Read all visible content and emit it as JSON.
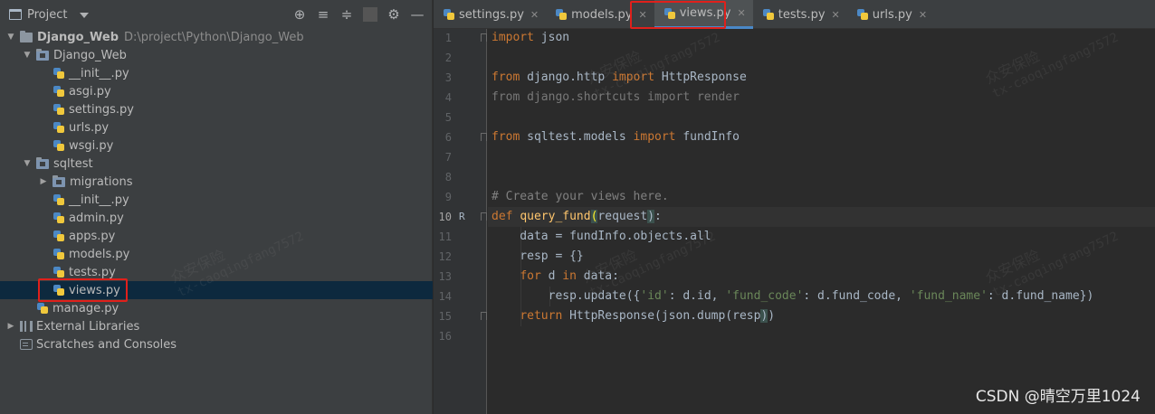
{
  "project_panel": {
    "title": "Project",
    "tree": [
      {
        "label": "Django_Web",
        "path": "D:\\project\\Python\\Django_Web",
        "kind": "folder",
        "depth": 0,
        "expanded": true,
        "bold": true
      },
      {
        "label": "Django_Web",
        "kind": "module",
        "depth": 1,
        "expanded": true
      },
      {
        "label": "__init__.py",
        "kind": "py",
        "depth": 2
      },
      {
        "label": "asgi.py",
        "kind": "py",
        "depth": 2
      },
      {
        "label": "settings.py",
        "kind": "py",
        "depth": 2
      },
      {
        "label": "urls.py",
        "kind": "py",
        "depth": 2
      },
      {
        "label": "wsgi.py",
        "kind": "py",
        "depth": 2
      },
      {
        "label": "sqltest",
        "kind": "module",
        "depth": 1,
        "expanded": true
      },
      {
        "label": "migrations",
        "kind": "module",
        "depth": 2,
        "expanded": false
      },
      {
        "label": "__init__.py",
        "kind": "py",
        "depth": 2
      },
      {
        "label": "admin.py",
        "kind": "py",
        "depth": 2
      },
      {
        "label": "apps.py",
        "kind": "py",
        "depth": 2
      },
      {
        "label": "models.py",
        "kind": "py",
        "depth": 2
      },
      {
        "label": "tests.py",
        "kind": "py",
        "depth": 2
      },
      {
        "label": "views.py",
        "kind": "py",
        "depth": 2,
        "selected": true
      },
      {
        "label": "manage.py",
        "kind": "py",
        "depth": 1
      },
      {
        "label": "External Libraries",
        "kind": "lib",
        "depth": 0,
        "expanded": false
      },
      {
        "label": "Scratches and Consoles",
        "kind": "scratch",
        "depth": 0
      }
    ]
  },
  "tabs": [
    {
      "label": "settings.py"
    },
    {
      "label": "models.py"
    },
    {
      "label": "views.py",
      "active": true
    },
    {
      "label": "tests.py"
    },
    {
      "label": "urls.py"
    }
  ],
  "editor": {
    "current_line": 10,
    "line_numbers": [
      "1",
      "2",
      "3",
      "4",
      "5",
      "6",
      "7",
      "8",
      "9",
      "10",
      "11",
      "12",
      "13",
      "14",
      "15",
      "16"
    ],
    "gutter_marker": "R",
    "lines": [
      [
        {
          "t": "import",
          "c": "kw"
        },
        {
          "t": " json"
        }
      ],
      [],
      [
        {
          "t": "from",
          "c": "kw"
        },
        {
          "t": " django.http "
        },
        {
          "t": "import",
          "c": "kw"
        },
        {
          "t": " HttpResponse"
        }
      ],
      [
        {
          "t": "from django.shortcuts import render",
          "c": "dim"
        }
      ],
      [],
      [
        {
          "t": "from",
          "c": "kw"
        },
        {
          "t": " sqltest.models "
        },
        {
          "t": "import",
          "c": "kw"
        },
        {
          "t": " fundInfo"
        }
      ],
      [],
      [],
      [
        {
          "t": "# Create your views here.",
          "c": "cm"
        }
      ],
      [
        {
          "t": "def",
          "c": "kw"
        },
        {
          "t": " "
        },
        {
          "t": "query_fund",
          "c": "fn"
        },
        {
          "t": "(",
          "c": "hl"
        },
        {
          "t": "request"
        },
        {
          "t": ")",
          "c": "hl2"
        },
        {
          "t": ":"
        }
      ],
      [
        {
          "t": "    data = fundInfo.objects.all"
        }
      ],
      [
        {
          "t": "    resp = {}"
        }
      ],
      [
        {
          "t": "    "
        },
        {
          "t": "for",
          "c": "kw"
        },
        {
          "t": " d "
        },
        {
          "t": "in",
          "c": "kw"
        },
        {
          "t": " data:"
        }
      ],
      [
        {
          "t": "        resp.update({"
        },
        {
          "t": "'id'",
          "c": "str"
        },
        {
          "t": ": d.id, "
        },
        {
          "t": "'fund_code'",
          "c": "str"
        },
        {
          "t": ": d.fund_code, "
        },
        {
          "t": "'fund_name'",
          "c": "str"
        },
        {
          "t": ": d.fund_name})"
        }
      ],
      [
        {
          "t": "    "
        },
        {
          "t": "return",
          "c": "kw"
        },
        {
          "t": " HttpResponse(json.dump(resp"
        },
        {
          "t": ")",
          "c": "hl2"
        },
        {
          "t": ")"
        }
      ],
      []
    ]
  },
  "watermark": {
    "line1": "众安保险",
    "line2": "tx-caoqingfang7572"
  },
  "csdn_credit": "CSDN @晴空万里1024",
  "colors": {
    "accent": "#4a88c7",
    "highlight_box": "#e0201b"
  }
}
